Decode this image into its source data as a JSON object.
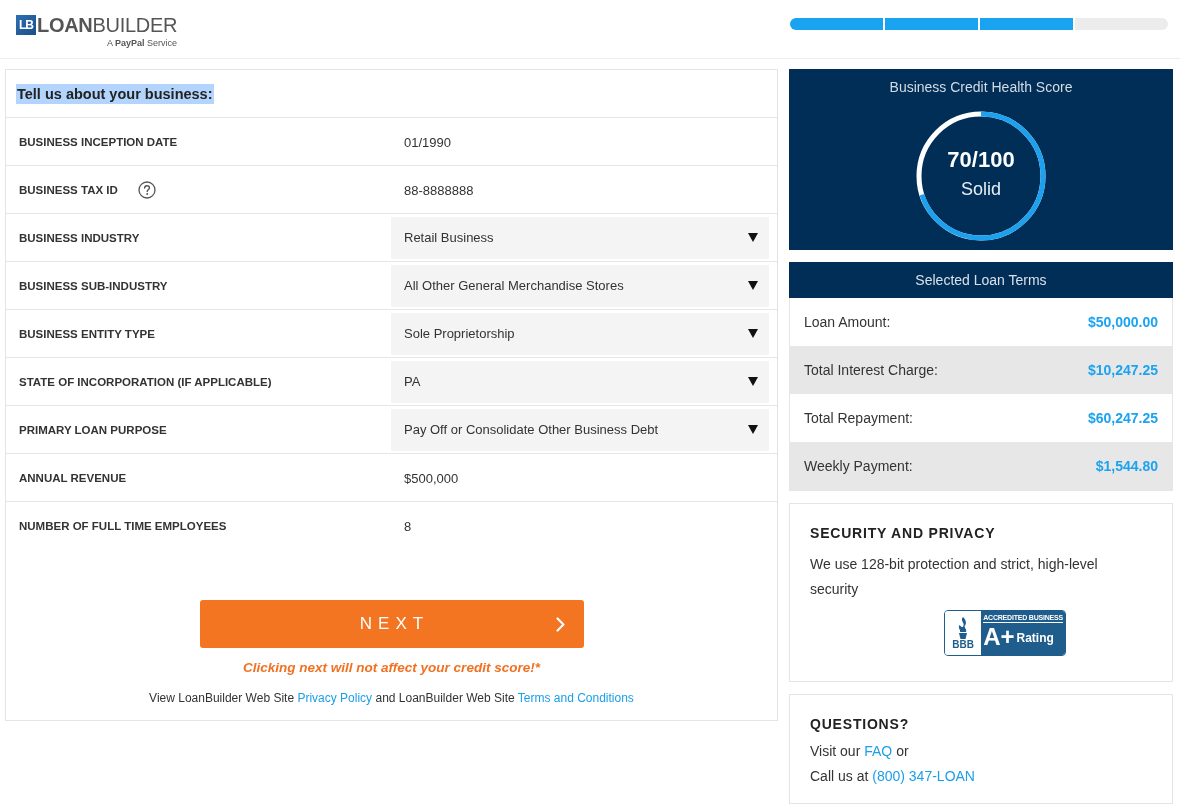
{
  "header": {
    "logo": {
      "mark": "LB",
      "wordmark": "**LOAN**BUILDER",
      "tagline": "A **PayPal** Service"
    },
    "progress": [
      {
        "completed": true
      },
      {
        "completed": true
      },
      {
        "completed": true
      },
      {
        "completed": false
      }
    ]
  },
  "form": {
    "heading": {
      "text": "Tell us about your business:",
      "highlighted": true
    },
    "fields": [
      {
        "label": "BUSINESS INCEPTION DATE",
        "kind": "text",
        "value": "01/1990",
        "help": false
      },
      {
        "label": "BUSINESS TAX ID",
        "kind": "text",
        "value": "88-8888888",
        "help": true
      },
      {
        "label": "BUSINESS INDUSTRY",
        "kind": "select",
        "value": "Retail Business",
        "help": false
      },
      {
        "label": "BUSINESS SUB-INDUSTRY",
        "kind": "select",
        "value": "All Other General Merchandise Stores",
        "help": false
      },
      {
        "label": "BUSINESS ENTITY TYPE",
        "kind": "select",
        "value": "Sole Proprietorship",
        "help": false
      },
      {
        "label": "STATE OF INCORPORATION (IF APPLICABLE)",
        "kind": "select",
        "value": "PA",
        "help": false
      },
      {
        "label": "PRIMARY LOAN PURPOSE",
        "kind": "select",
        "value": "Pay Off or Consolidate Other Business Debt",
        "help": false
      },
      {
        "label": "ANNUAL REVENUE",
        "kind": "text",
        "value": "$500,000",
        "help": false
      },
      {
        "label": "NUMBER OF FULL TIME EMPLOYEES",
        "kind": "text",
        "value": "8",
        "help": false
      }
    ],
    "next_button": {
      "label": "NEXT"
    },
    "note": "Clicking next will not affect your credit score!*",
    "footer": [
      {
        "kind": "text",
        "text": "View LoanBuilder Web Site"
      },
      {
        "kind": "link",
        "text": "Privacy Policy"
      },
      {
        "kind": "text",
        "text": "and LoanBuilder Web Site"
      },
      {
        "kind": "link",
        "text": "Terms and Conditions"
      }
    ]
  },
  "score_card": {
    "title": "Business Credit Health Score",
    "score": "70/100",
    "rating": "Solid",
    "level": 0.7
  },
  "loan_terms": {
    "title": "Selected Loan Terms",
    "rows": [
      {
        "label": "Loan Amount:",
        "value": "$50,000.00"
      },
      {
        "label": "Total Interest Charge:",
        "value": "$10,247.25"
      },
      {
        "label": "Total Repayment:",
        "value": "$60,247.25"
      },
      {
        "label": "Weekly Payment:",
        "value": "$1,544.80"
      }
    ]
  },
  "security": {
    "title": "SECURITY AND PRIVACY",
    "text": "We use 128-bit protection and strict, high-level security",
    "seal": {
      "mark": "BBB",
      "banner": "ACCREDITED BUSINESS",
      "grade": "A+",
      "label": "Rating"
    }
  },
  "questions": {
    "title": "QUESTIONS?",
    "lines": [
      [
        {
          "kind": "text",
          "text": "Visit our"
        },
        {
          "kind": "link",
          "text": "FAQ"
        },
        {
          "kind": "text",
          "text": "or"
        }
      ],
      [
        {
          "kind": "text",
          "text": "Call us at"
        },
        {
          "kind": "link",
          "text": "(800) 347-LOAN"
        }
      ]
    ]
  }
}
